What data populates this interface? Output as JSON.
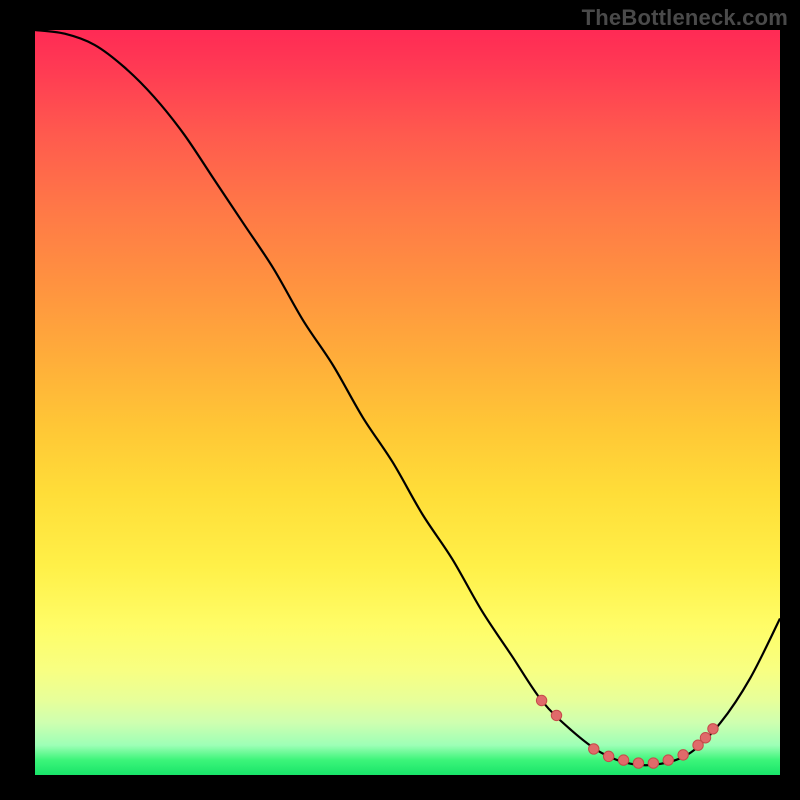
{
  "watermark": "TheBottleneck.com",
  "colors": {
    "frame": "#000000",
    "curve": "#000000",
    "dot_fill": "#e06a6a",
    "dot_stroke": "#c64a4a"
  },
  "chart_data": {
    "type": "line",
    "title": "",
    "xlabel": "",
    "ylabel": "",
    "xlim": [
      0,
      100
    ],
    "ylim": [
      0,
      100
    ],
    "series": [
      {
        "name": "bottleneck-curve",
        "x": [
          0,
          4,
          8,
          12,
          16,
          20,
          24,
          28,
          32,
          36,
          40,
          44,
          48,
          52,
          56,
          60,
          64,
          68,
          72,
          76,
          80,
          84,
          88,
          92,
          96,
          100
        ],
        "y": [
          100,
          99.5,
          98,
          95,
          91,
          86,
          80,
          74,
          68,
          61,
          55,
          48,
          42,
          35,
          29,
          22,
          16,
          10,
          6,
          3,
          1.5,
          1.5,
          3,
          7,
          13,
          21
        ]
      }
    ],
    "highlight_dots": {
      "x": [
        68,
        70,
        75,
        77,
        79,
        81,
        83,
        85,
        87,
        89,
        90,
        91
      ],
      "y": [
        10,
        8,
        3.5,
        2.5,
        2,
        1.6,
        1.6,
        2,
        2.7,
        4,
        5,
        6.2
      ]
    }
  }
}
